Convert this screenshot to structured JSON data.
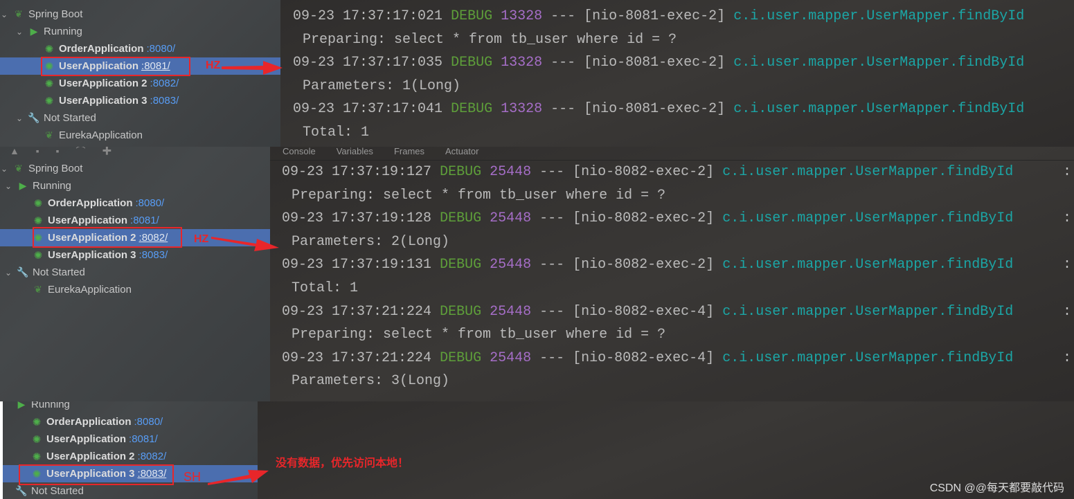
{
  "colors": {
    "selection": "#4b6eaf",
    "annotation": "#e8262a",
    "debug": "#5e9f3a",
    "pid": "#a66ec8",
    "logger": "#1ba6a6",
    "port": "#589df6"
  },
  "panel1": {
    "tree": [
      {
        "label": "Spring Boot",
        "kind": "group",
        "icon": "spring-boot-icon",
        "chev": true,
        "indent": 0
      },
      {
        "label": "Running",
        "kind": "group",
        "icon": "play-icon",
        "chev": true,
        "indent": 1
      },
      {
        "label": "OrderApplication",
        "port": ":8080/",
        "kind": "app",
        "icon": "bug-icon",
        "indent": 2
      },
      {
        "label": "UserApplication",
        "port": ":8081/",
        "kind": "app",
        "icon": "bug-icon",
        "indent": 2,
        "selected": true
      },
      {
        "label": "UserApplication 2",
        "port": ":8082/",
        "kind": "app",
        "icon": "bug-icon",
        "indent": 2
      },
      {
        "label": "UserApplication 3",
        "port": ":8083/",
        "kind": "app",
        "icon": "bug-icon",
        "indent": 2
      },
      {
        "label": "Not Started",
        "kind": "group",
        "icon": "wrench-icon",
        "chev": true,
        "indent": 1
      },
      {
        "label": "EurekaApplication",
        "kind": "plain",
        "icon": "spring-boot-icon",
        "indent": 2
      }
    ],
    "annotation": "HZ",
    "logs": [
      {
        "time": "09-23 17:37:17:021",
        "level": "DEBUG",
        "pid": "13328",
        "sep": "---",
        "thread": "[nio-8081-exec-2]",
        "logger": "c.i.user.mapper.UserMapper.findById"
      },
      {
        "text": "Preparing: select * from tb_user where id = ?"
      },
      {
        "time": "09-23 17:37:17:035",
        "level": "DEBUG",
        "pid": "13328",
        "sep": "---",
        "thread": "[nio-8081-exec-2]",
        "logger": "c.i.user.mapper.UserMapper.findById"
      },
      {
        "text": "Parameters: 1(Long)"
      },
      {
        "time": "09-23 17:37:17:041",
        "level": "DEBUG",
        "pid": "13328",
        "sep": "---",
        "thread": "[nio-8081-exec-2]",
        "logger": "c.i.user.mapper.UserMapper.findById"
      },
      {
        "text": "Total: 1"
      }
    ]
  },
  "panel2": {
    "tabs": [
      "Console",
      "Variables",
      "Frames",
      "Actuator"
    ],
    "tree": [
      {
        "label": "Spring Boot",
        "kind": "group",
        "icon": "spring-boot-icon",
        "chev": true,
        "indent": 0
      },
      {
        "label": "Running",
        "kind": "group",
        "icon": "play-icon",
        "chev": true,
        "indent": 1
      },
      {
        "label": "OrderApplication",
        "port": ":8080/",
        "kind": "app",
        "icon": "bug-icon",
        "indent": 2
      },
      {
        "label": "UserApplication",
        "port": ":8081/",
        "kind": "app",
        "icon": "bug-icon",
        "indent": 2
      },
      {
        "label": "UserApplication 2",
        "port": ":8082/",
        "kind": "app",
        "icon": "bug-icon",
        "indent": 2,
        "selected": true
      },
      {
        "label": "UserApplication 3",
        "port": ":8083/",
        "kind": "app",
        "icon": "bug-icon",
        "indent": 2
      },
      {
        "label": "Not Started",
        "kind": "group",
        "icon": "wrench-icon",
        "chev": true,
        "indent": 1
      },
      {
        "label": "EurekaApplication",
        "kind": "plain",
        "icon": "spring-boot-icon",
        "indent": 2
      }
    ],
    "annotation": "HZ",
    "logs": [
      {
        "time": "09-23 17:37:19:127",
        "level": "DEBUG",
        "pid": "25448",
        "sep": "---",
        "thread": "[nio-8082-exec-2]",
        "logger": "c.i.user.mapper.UserMapper.findById",
        "tail": ":"
      },
      {
        "text": "Preparing: select * from tb_user where id = ?"
      },
      {
        "time": "09-23 17:37:19:128",
        "level": "DEBUG",
        "pid": "25448",
        "sep": "---",
        "thread": "[nio-8082-exec-2]",
        "logger": "c.i.user.mapper.UserMapper.findById",
        "tail": ":"
      },
      {
        "text": "Parameters: 2(Long)"
      },
      {
        "time": "09-23 17:37:19:131",
        "level": "DEBUG",
        "pid": "25448",
        "sep": "---",
        "thread": "[nio-8082-exec-2]",
        "logger": "c.i.user.mapper.UserMapper.findById",
        "tail": ":"
      },
      {
        "text": "Total: 1"
      },
      {
        "time": "09-23 17:37:21:224",
        "level": "DEBUG",
        "pid": "25448",
        "sep": "---",
        "thread": "[nio-8082-exec-4]",
        "logger": "c.i.user.mapper.UserMapper.findById",
        "tail": ":"
      },
      {
        "text": "Preparing: select * from tb_user where id = ?"
      },
      {
        "time": "09-23 17:37:21:224",
        "level": "DEBUG",
        "pid": "25448",
        "sep": "---",
        "thread": "[nio-8082-exec-4]",
        "logger": "c.i.user.mapper.UserMapper.findById",
        "tail": ":"
      },
      {
        "text": "Parameters: 3(Long)"
      }
    ]
  },
  "panel3": {
    "tree": [
      {
        "label": "Running",
        "kind": "group",
        "icon": "play-icon",
        "indent": 0
      },
      {
        "label": "OrderApplication",
        "port": ":8080/",
        "kind": "app",
        "icon": "bug-icon",
        "indent": 1
      },
      {
        "label": "UserApplication",
        "port": ":8081/",
        "kind": "app",
        "icon": "bug-icon",
        "indent": 1
      },
      {
        "label": "UserApplication 2",
        "port": ":8082/",
        "kind": "app",
        "icon": "bug-icon",
        "indent": 1
      },
      {
        "label": "UserApplication 3",
        "port": ":8083/",
        "kind": "app",
        "icon": "bug-icon",
        "indent": 1,
        "selected": true
      },
      {
        "label": "Not Started",
        "kind": "group",
        "icon": "wrench-icon",
        "indent": 0
      }
    ],
    "annotation": "SH",
    "note": "没有数据，优先访问本地！"
  },
  "watermark": "CSDN @@每天都要敲代码"
}
